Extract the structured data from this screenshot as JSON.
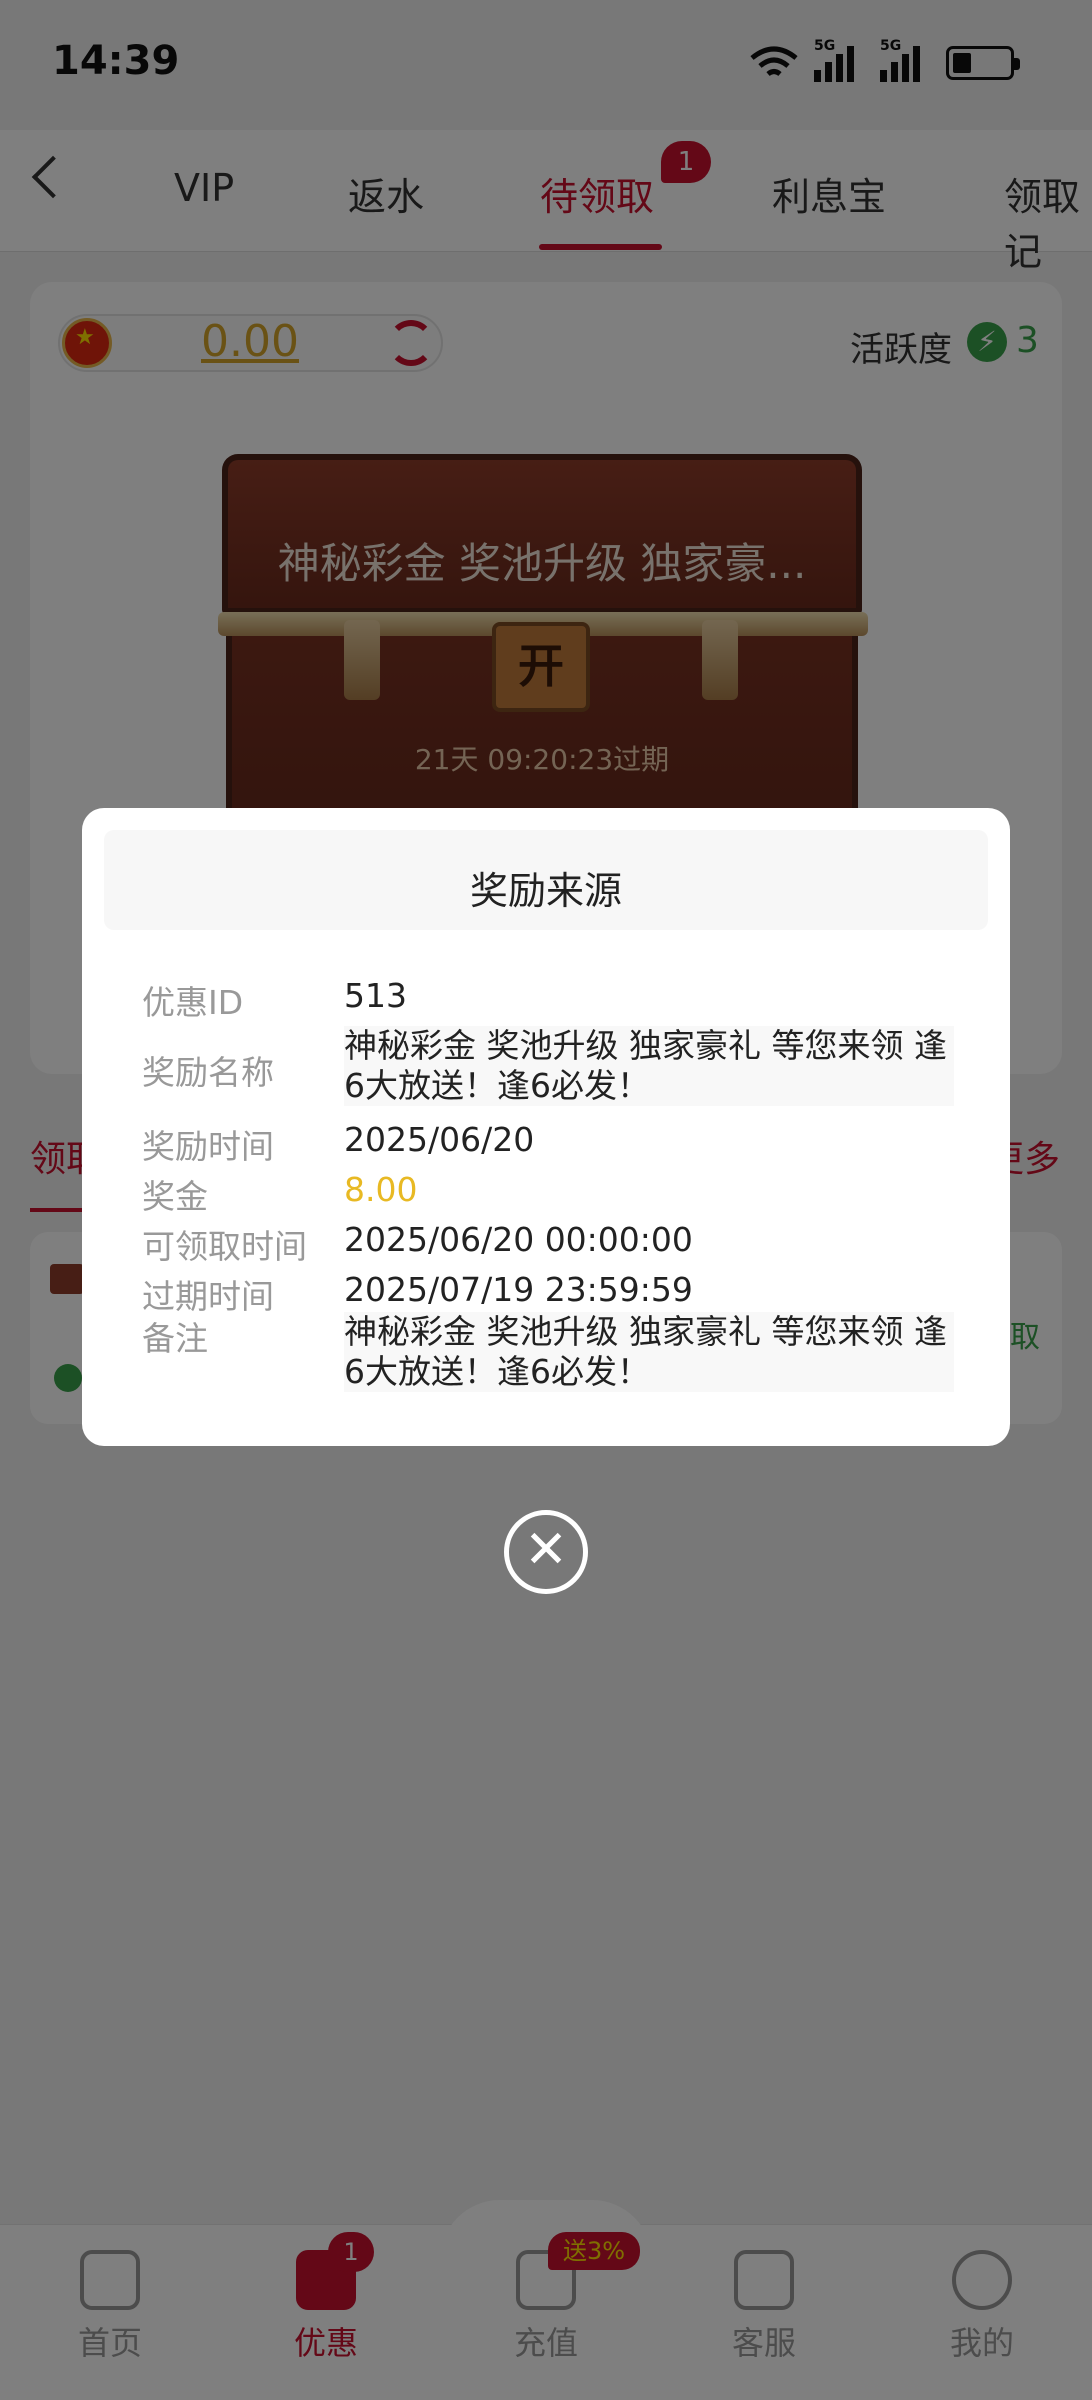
{
  "status_bar": {
    "time": "14:39",
    "net1": "5G",
    "net2": "5G",
    "icons": [
      "wifi-icon",
      "signal-icon",
      "signal-icon",
      "battery-icon"
    ]
  },
  "tabs": [
    {
      "label": "VIP"
    },
    {
      "label": "返水"
    },
    {
      "label": "待领取",
      "active": true,
      "badge": "1"
    },
    {
      "label": "利息宝"
    },
    {
      "label": "领取记"
    }
  ],
  "wallet": {
    "balance": "0.00",
    "activity_label": "活跃度",
    "activity_value": "3"
  },
  "chest": {
    "title": "神秘彩金 奖池升级 独家豪...",
    "open_label": "开",
    "expire_text": "21天 09:20:23过期"
  },
  "section": {
    "title": "领取",
    "more": "更多"
  },
  "record": {
    "claim": "领取"
  },
  "modal": {
    "title": "奖励来源",
    "rows": [
      {
        "label": "优惠ID",
        "value": "513"
      },
      {
        "label": "奖励名称",
        "value": "神秘彩金 奖池升级 独家豪礼 等您来领 逢6大放送！逢6必发！"
      },
      {
        "label": "奖励时间",
        "value": "2025/06/20"
      },
      {
        "label": "奖金",
        "value": "8.00"
      },
      {
        "label": "可领取时间",
        "value": "2025/06/20 00:00:00"
      },
      {
        "label": "过期时间",
        "value": "2025/07/19 23:59:59"
      },
      {
        "label": "备注",
        "value": "神秘彩金 奖池升级 独家豪礼 等您来领 逢6大放送！逢6必发！"
      }
    ],
    "close_icon": "✕"
  },
  "bottom_nav": [
    {
      "label": "首页",
      "icon": "home-icon"
    },
    {
      "label": "优惠",
      "icon": "gift-icon",
      "active": true,
      "badge": "1"
    },
    {
      "label": "充值",
      "icon": "recharge-icon",
      "promo": "送3%"
    },
    {
      "label": "客服",
      "icon": "headset-icon"
    },
    {
      "label": "我的",
      "icon": "user-icon"
    }
  ],
  "colors": {
    "brand": "#c8102e",
    "gold": "#e8b923",
    "green": "#39a04a"
  }
}
